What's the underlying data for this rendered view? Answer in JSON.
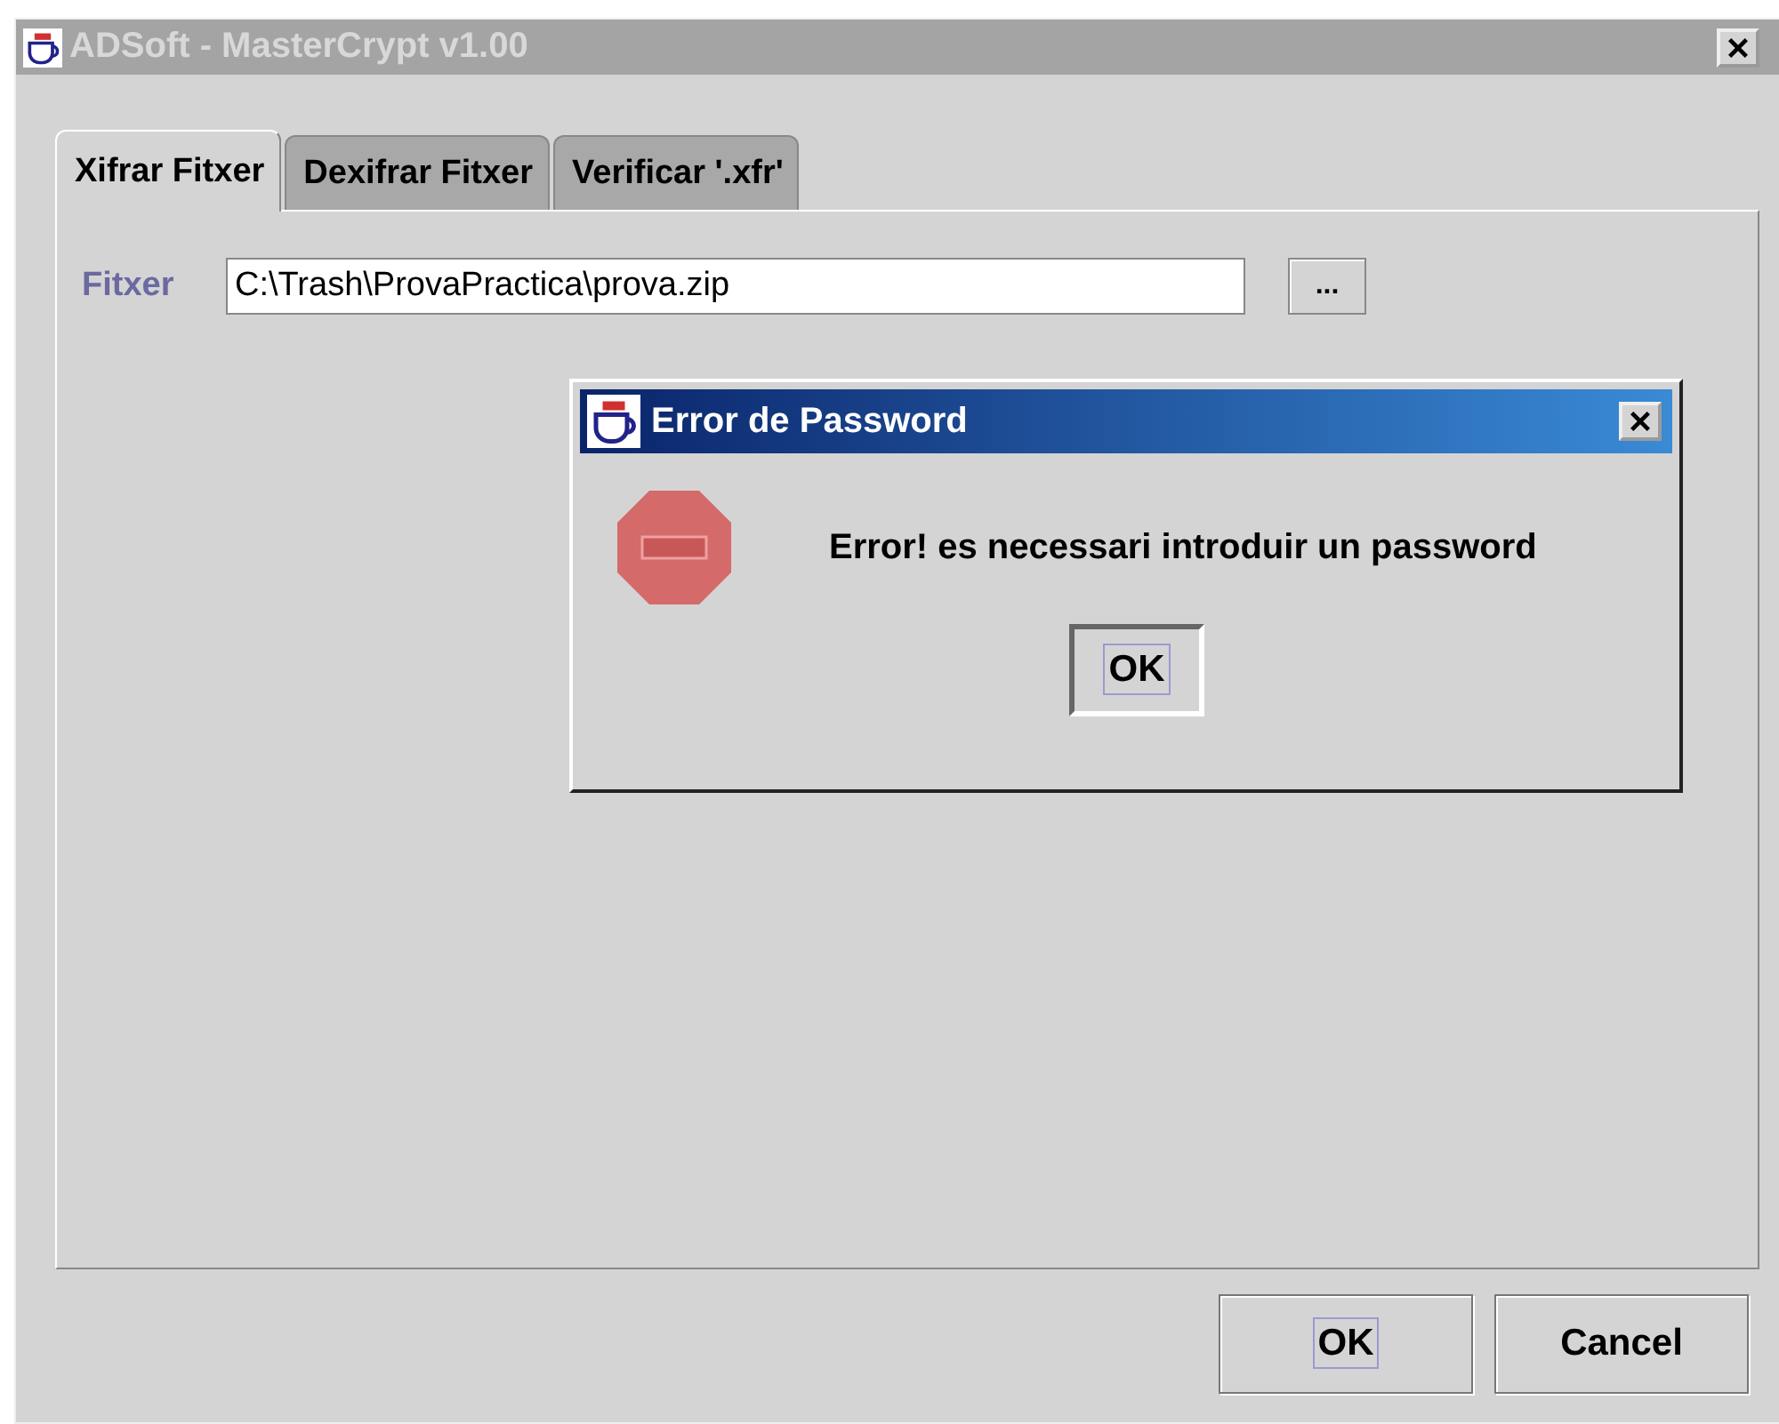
{
  "window": {
    "title": "ADSoft - MasterCrypt v1.00",
    "active": false
  },
  "tabs": [
    {
      "label": "Xifrar Fitxer",
      "selected": true
    },
    {
      "label": "Dexifrar Fitxer",
      "selected": false
    },
    {
      "label": "Verificar '.xfr'",
      "selected": false
    }
  ],
  "file_field": {
    "label": "Fitxer",
    "value": "C:\\Trash\\ProvaPractica\\prova.zip",
    "browse_button": "..."
  },
  "buttons": [
    {
      "label": "OK",
      "focused": true
    },
    {
      "label": "Cancel",
      "focused": false
    }
  ],
  "dialog": {
    "title": "Error de Password",
    "active": true,
    "message": "Error! es necessari introduir un password",
    "buttons": [
      {
        "label": "OK",
        "focused": true
      }
    ]
  }
}
